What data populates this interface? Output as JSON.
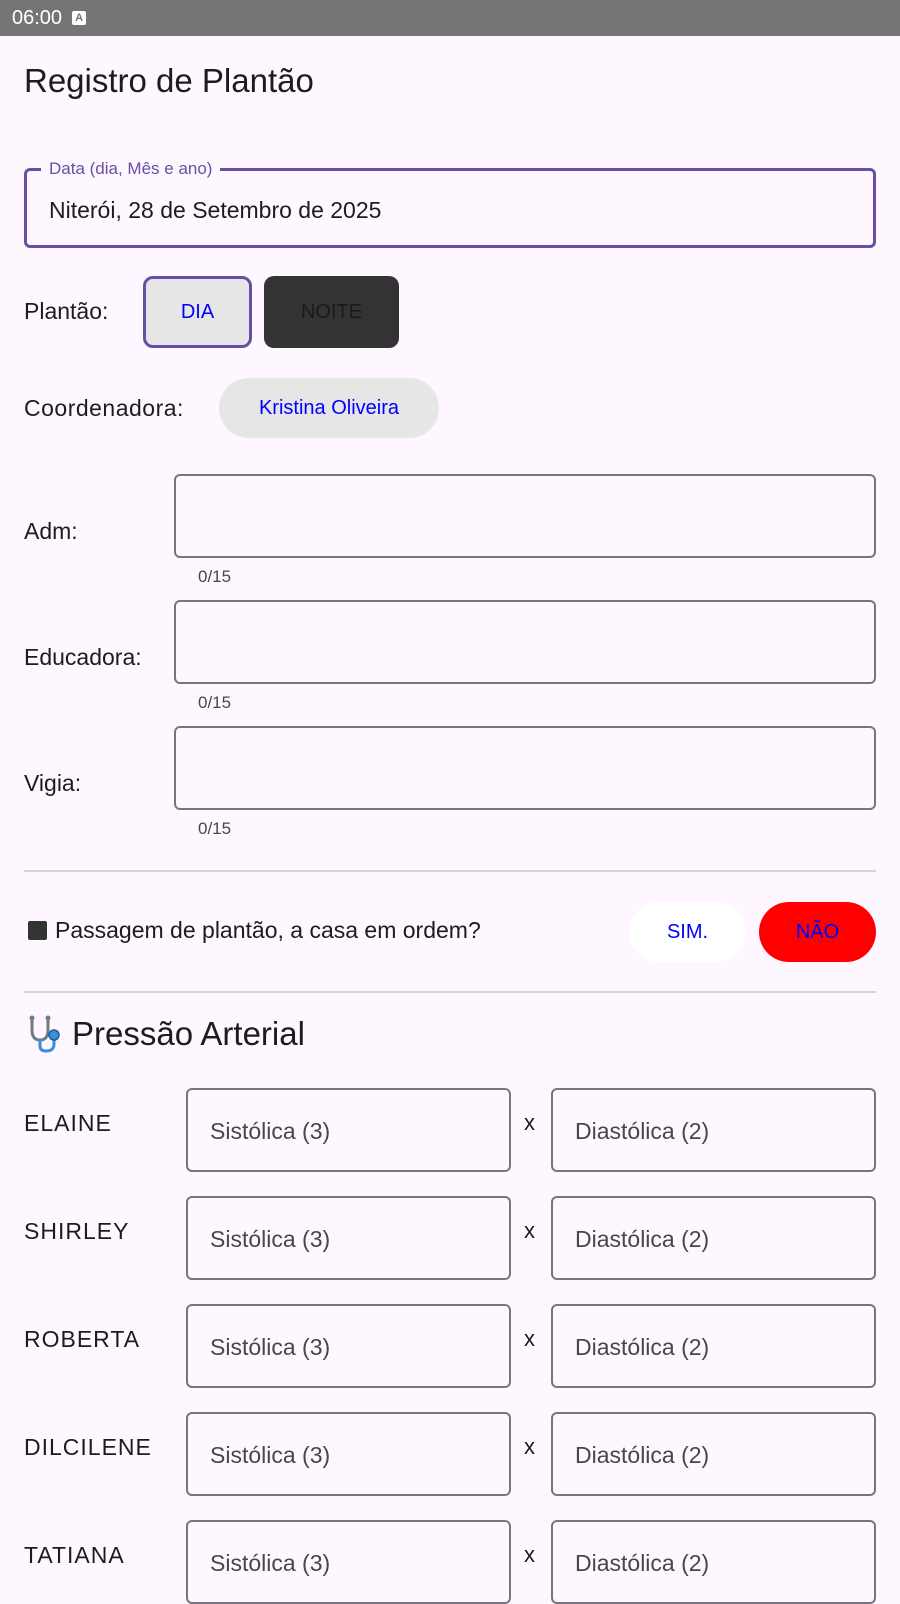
{
  "status_bar": {
    "time": "06:00",
    "notification_icon_letter": "A"
  },
  "page": {
    "title": "Registro de Plantão"
  },
  "date_field": {
    "label": "Data (dia, Mês e ano)",
    "value": "Niterói, 28 de Setembro de 2025"
  },
  "plantao": {
    "label": "Plantão:",
    "day_label": "DIA",
    "night_label": "NOITE",
    "selected": "DIA"
  },
  "coordenadora": {
    "label": "Coordenadora:",
    "value": "Kristina Oliveira"
  },
  "staff_fields": [
    {
      "label": "Adm:",
      "value": "",
      "counter": "0/15"
    },
    {
      "label": "Educadora:",
      "value": "",
      "counter": "0/15"
    },
    {
      "label": "Vigia:",
      "value": "",
      "counter": "0/15"
    }
  ],
  "passagem": {
    "icon": "black-square-icon",
    "question": "Passagem de plantão, a casa em ordem?",
    "yes_label": "SIM.",
    "no_label": "NÃO",
    "selected": "NÃO"
  },
  "pressao": {
    "icon": "stethoscope-icon",
    "title": "Pressão Arterial",
    "separator": "x",
    "systolic_placeholder": "Sistólica (3)",
    "diastolic_placeholder": "Diastólica (2)",
    "patients": [
      "ELAINE",
      "SHIRLEY",
      "ROBERTA",
      "DILCILENE",
      "TATIANA"
    ]
  },
  "colors": {
    "accent": "#6750A4",
    "background": "#FEF7FF",
    "link_blue": "#0000FF",
    "no_button": "#FF0000",
    "night_button": "#333333"
  }
}
